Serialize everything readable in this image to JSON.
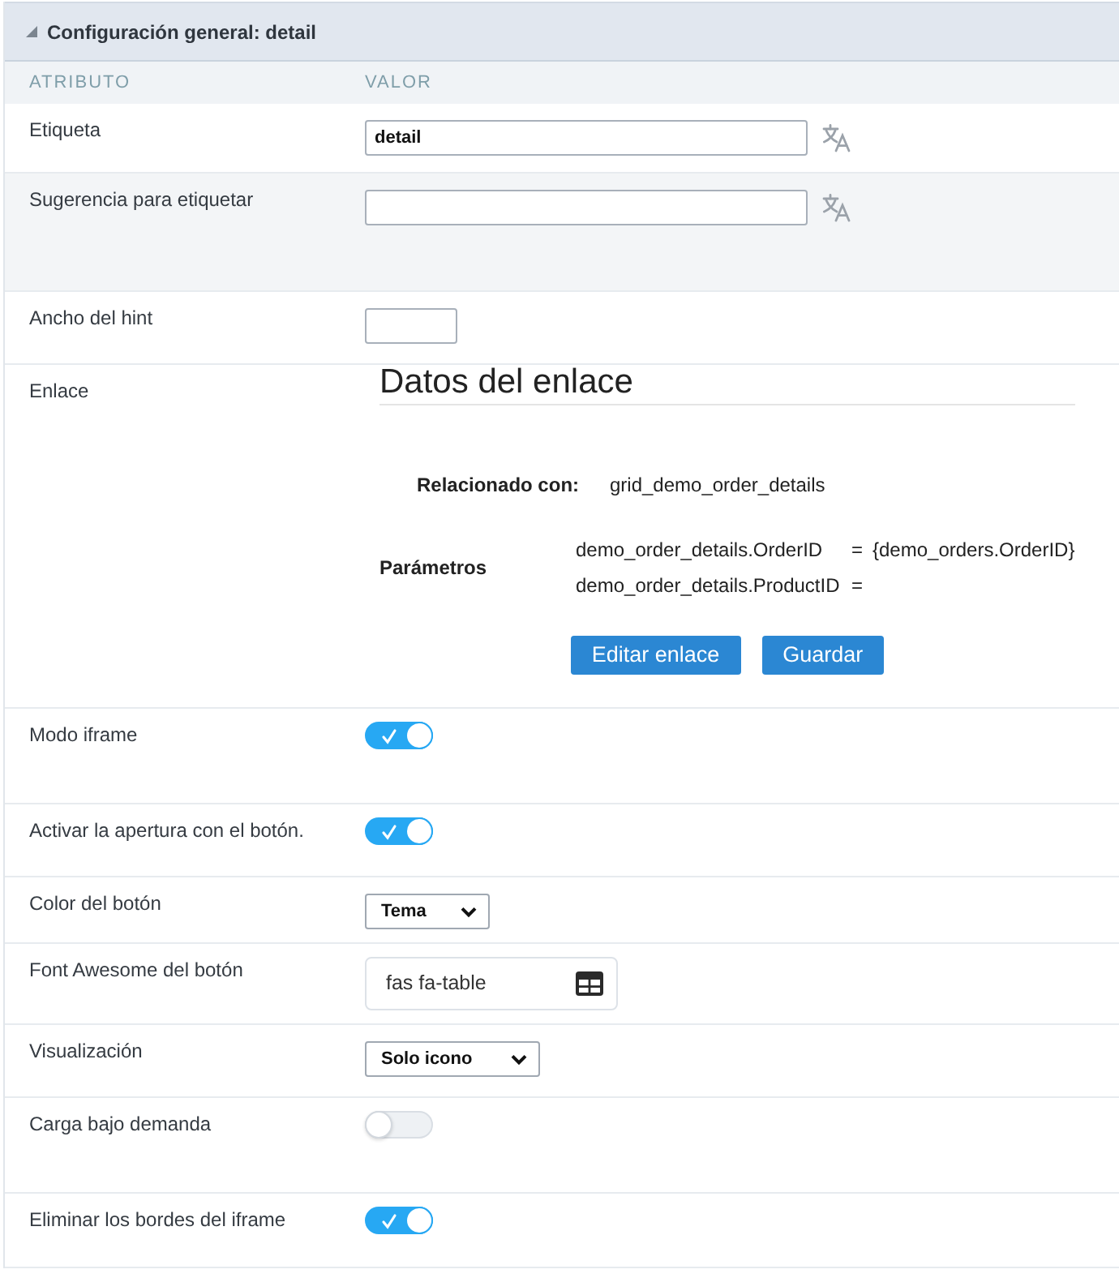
{
  "panel": {
    "title": "Configuración general: detail",
    "expanded": true
  },
  "columns": [
    "ATRIBUTO",
    "VALOR"
  ],
  "rows": [
    {
      "kind": "text",
      "label": "Etiqueta",
      "value": "detail",
      "translatable": true,
      "highlighted": false
    },
    {
      "kind": "text",
      "label": "Sugerencia para etiquetar",
      "translatable": true,
      "highlighted": true
    },
    {
      "kind": "short-text",
      "label": "Ancho del hint",
      "highlighted": false
    },
    {
      "kind": "link",
      "label": "Enlace",
      "highlighted": false,
      "link": {
        "heading": "Datos del enlace",
        "related_label": "Relacionado con:",
        "related_value": "grid_demo_order_details",
        "params_label": "Parámetros",
        "params": [
          {
            "name": "demo_order_details.OrderID",
            "operator": "=",
            "value": "{demo_orders.OrderID}"
          },
          {
            "name": "demo_order_details.ProductID",
            "operator": "="
          }
        ],
        "buttons": [
          "Editar enlace",
          "Guardar"
        ]
      }
    },
    {
      "kind": "toggle",
      "label": "Modo iframe",
      "on": true,
      "highlighted": false
    },
    {
      "kind": "toggle",
      "label": "Activar la apertura con el botón.",
      "on": true,
      "highlighted": false
    },
    {
      "kind": "select",
      "label": "Color del botón",
      "value": "Tema",
      "highlighted": false
    },
    {
      "kind": "icon-field",
      "label": "Font Awesome del botón",
      "value": "fas fa-table",
      "highlighted": false
    },
    {
      "kind": "select",
      "label": "Visualización",
      "value": "Solo icono",
      "highlighted": false
    },
    {
      "kind": "toggle",
      "label": "Carga bajo demanda",
      "on": false,
      "highlighted": false
    },
    {
      "kind": "toggle",
      "label": "Eliminar los bordes del iframe",
      "on": true,
      "highlighted": false
    }
  ]
}
